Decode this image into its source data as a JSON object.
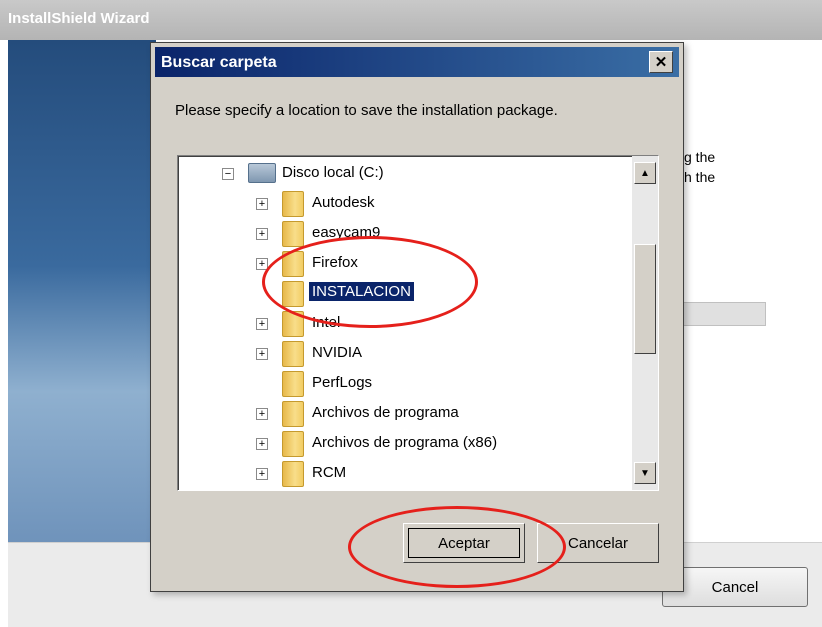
{
  "background_window": {
    "title": "InstallShield Wizard",
    "text_lines": [
      "g the",
      "h the"
    ],
    "cancel_label": "Cancel"
  },
  "dialog": {
    "title": "Buscar carpeta",
    "close_glyph": "✕",
    "message": "Please specify a location to save the installation package.",
    "tree": {
      "drive_label": "Disco local (C:)",
      "items": [
        {
          "label": "Autodesk",
          "expander": "+"
        },
        {
          "label": "easycam9",
          "expander": "+"
        },
        {
          "label": "Firefox",
          "expander": "+"
        },
        {
          "label": "INSTALACION",
          "expander": "",
          "selected": true
        },
        {
          "label": "Intel",
          "expander": "+"
        },
        {
          "label": "NVIDIA",
          "expander": "+"
        },
        {
          "label": "PerfLogs",
          "expander": ""
        },
        {
          "label": "Archivos de programa",
          "expander": "+"
        },
        {
          "label": "Archivos de programa (x86)",
          "expander": "+"
        },
        {
          "label": "RCM",
          "expander": "+"
        }
      ]
    },
    "accept_label": "Aceptar",
    "cancel_label": "Cancelar"
  },
  "annotation_color": "#e5201b"
}
